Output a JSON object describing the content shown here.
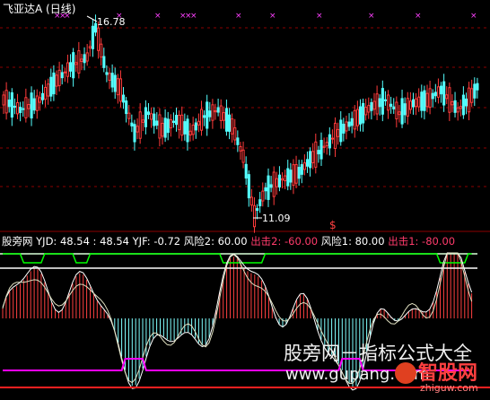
{
  "upper": {
    "title": "飞亚达A (日线)",
    "high_label": "16.78",
    "low_label": "11.09",
    "high_value": 16.78,
    "low_value": 11.09,
    "signal_glyph": "$"
  },
  "indicator": {
    "name": "股旁网",
    "yjd_label": "YJD: 48.54 : 48.54",
    "yjf_label": "YJF: -0.72",
    "risk2_label": "风险2: 60.00",
    "exit2_label": "出击2: -60.00",
    "risk1_label": "风险1: 80.00",
    "exit1_label": "出击1: -80.00"
  },
  "watermark": {
    "line1": "股旁网－指标公式大全",
    "url": "www.gupang.com",
    "logo_text": "智股网",
    "logo_url": "zhiguw.com"
  },
  "colors": {
    "background": "#000000",
    "up_candle": "#ff3b3b",
    "down_candle": "#54ffff",
    "marker": "#ff40ff",
    "grid": "#8b0000",
    "risk_line": "#00ff00",
    "exit_line": "#ff00ff",
    "title_text": "#ffffff",
    "exit_text": "#ff3b6b"
  }
}
